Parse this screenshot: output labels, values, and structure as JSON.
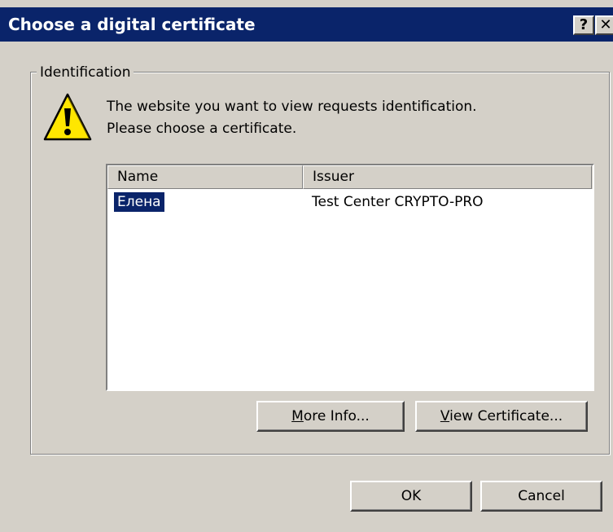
{
  "dialog": {
    "title": "Choose a digital certificate",
    "help_glyph": "?",
    "close_glyph": "✕"
  },
  "group": {
    "legend": "Identification",
    "message_line1": "The website you want to view requests identification.",
    "message_line2": "Please choose a certificate."
  },
  "list": {
    "columns": [
      "Name",
      "Issuer"
    ],
    "rows": [
      {
        "name": "Елена",
        "issuer": "Test Center CRYPTO-PRO",
        "selected": true
      }
    ]
  },
  "buttons": {
    "more_info_mnemonic": "M",
    "more_info_rest": "ore Info...",
    "view_cert_mnemonic": "V",
    "view_cert_rest": "iew Certificate...",
    "ok": "OK",
    "cancel": "Cancel"
  },
  "colors": {
    "title_bar": "#0a246a",
    "face": "#d4d0c8",
    "selection": "#0a246a",
    "warning_fill": "#ffe600"
  },
  "icons": {
    "warning": "warning-icon",
    "help": "help-icon",
    "close": "close-icon"
  }
}
